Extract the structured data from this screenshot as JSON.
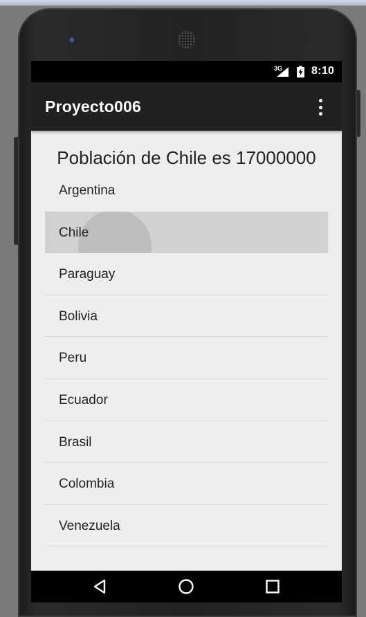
{
  "status_bar": {
    "network_type": "3G",
    "time": "8:10",
    "icons": [
      "signal-icon",
      "battery-charging-icon"
    ]
  },
  "app_bar": {
    "title": "Proyecto006",
    "menu_icon": "overflow-menu-icon"
  },
  "result_text": "Población de Chile es 17000000",
  "countries": [
    {
      "label": "Argentina",
      "selected": false
    },
    {
      "label": "Chile",
      "selected": true
    },
    {
      "label": "Paraguay",
      "selected": false
    },
    {
      "label": "Bolivia",
      "selected": false
    },
    {
      "label": "Peru",
      "selected": false
    },
    {
      "label": "Ecuador",
      "selected": false
    },
    {
      "label": "Brasil",
      "selected": false
    },
    {
      "label": "Colombia",
      "selected": false
    },
    {
      "label": "Venezuela",
      "selected": false
    }
  ],
  "nav_bar": {
    "buttons": [
      "back-icon",
      "home-icon",
      "recents-icon"
    ]
  },
  "colors": {
    "app_bar": "#212121",
    "screen_background": "#eeeeee",
    "selected_row": "#d1d1d1",
    "ripple": "#bdbdbd",
    "divider": "#d6d6d6"
  }
}
